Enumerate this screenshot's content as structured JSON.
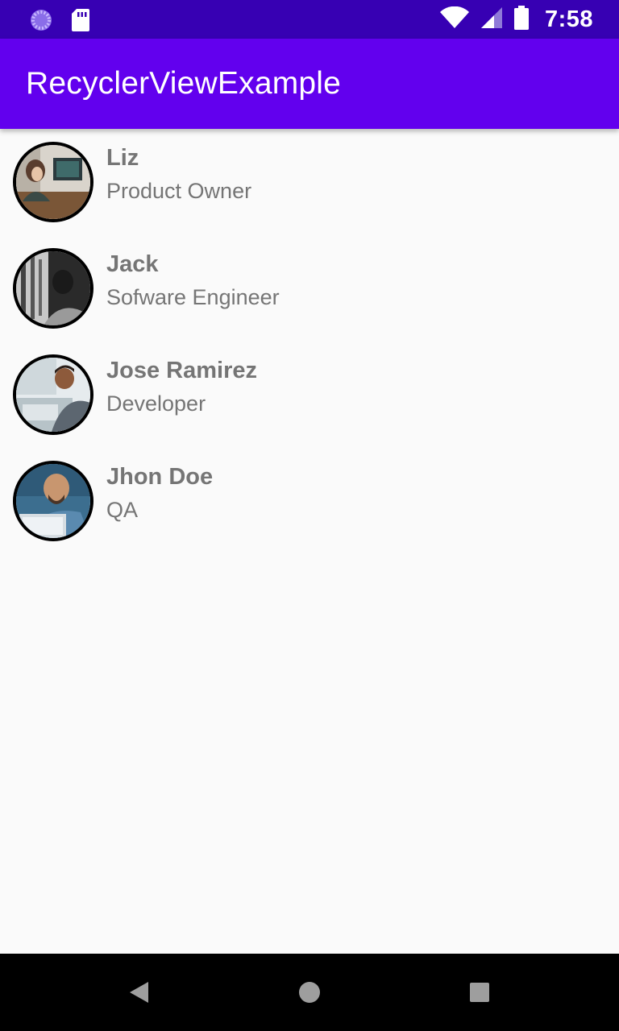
{
  "status_bar": {
    "time": "7:58",
    "icons": [
      "loading-icon",
      "sd-card-icon",
      "wifi-icon",
      "cellular-signal-icon",
      "battery-icon"
    ]
  },
  "app_bar": {
    "title": "RecyclerViewExample"
  },
  "contacts": [
    {
      "name": "Liz",
      "role": "Product Owner",
      "avatar": "avatar-photo"
    },
    {
      "name": "Jack",
      "role": "Sofware Engineer",
      "avatar": "avatar-photo"
    },
    {
      "name": "Jose Ramirez",
      "role": "Developer",
      "avatar": "avatar-photo"
    },
    {
      "name": "Jhon Doe",
      "role": "QA",
      "avatar": "avatar-photo"
    }
  ],
  "nav_bar": {
    "buttons": [
      "back-icon",
      "home-icon",
      "recents-icon"
    ]
  },
  "colors": {
    "status_bar": "#3700b3",
    "app_bar": "#6200ee",
    "background": "#fafafa",
    "text_secondary": "#757575"
  }
}
